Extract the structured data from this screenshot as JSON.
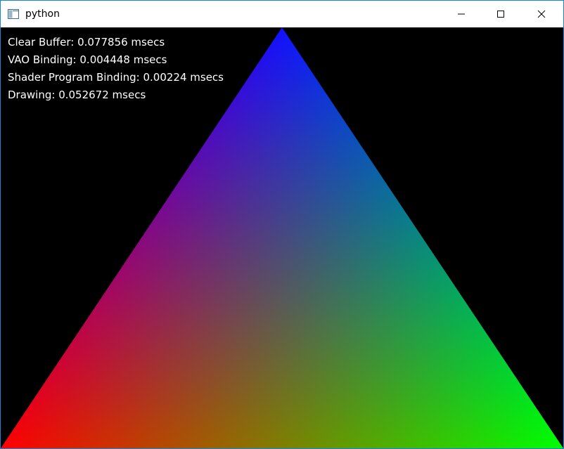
{
  "window": {
    "title": "python",
    "title_icon": "app-window-icon",
    "buttons": {
      "minimize_icon": "minimize-icon",
      "maximize_icon": "maximize-icon",
      "close_icon": "close-icon"
    },
    "border_color": "#1883d7"
  },
  "stats": [
    "Clear Buffer: 0.077856 msecs",
    "VAO Binding: 0.004448 msecs",
    "Shader Program Binding: 0.00224 msecs",
    "Drawing: 0.052672 msecs"
  ],
  "scene": {
    "background": "#000000",
    "vertex_colors": {
      "top": "#0000ff",
      "bottom_left": "#ff0000",
      "bottom_right": "#00ff00"
    }
  }
}
